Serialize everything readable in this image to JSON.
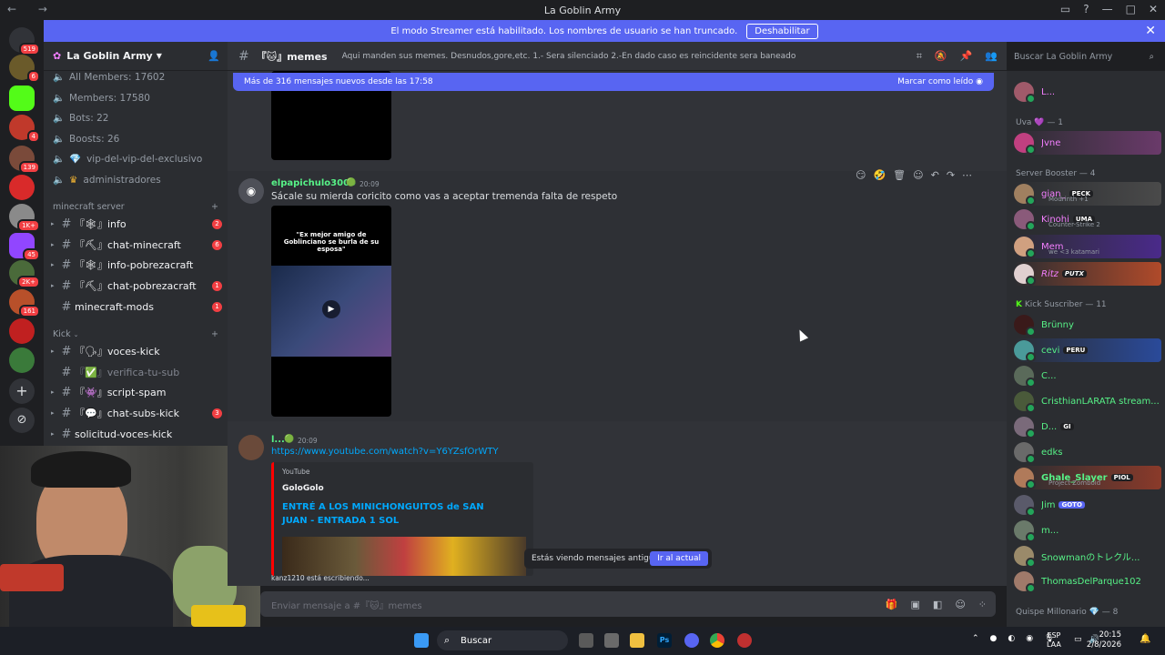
{
  "window": {
    "title": "La Goblin Army"
  },
  "banner": {
    "text": "El modo Streamer está habilitado. Los nombres de usuario se han truncado.",
    "button": "Deshabilitar"
  },
  "server": {
    "name": "La Goblin Army",
    "stats": [
      "All Members: 17602",
      "Members: 17580",
      "Bots: 22",
      "Boosts: 26",
      "vip-del-vip-del-exclusivo",
      "administradores"
    ],
    "categories": [
      {
        "label": "minecraft server",
        "channels": [
          {
            "name": "『🕸』info",
            "badge": "2"
          },
          {
            "name": "『⛏』chat-minecraft",
            "badge": "6"
          },
          {
            "name": "『🕸』info-pobrezacraft",
            "badge": ""
          },
          {
            "name": "『⛏』chat-pobrezacraft",
            "badge": "1"
          },
          {
            "name": "minecraft-mods",
            "badge": "1"
          }
        ]
      },
      {
        "label": "Kick",
        "channels": [
          {
            "name": "『🗣』voces-kick",
            "badge": ""
          },
          {
            "name": "『✅』verifica-tu-sub",
            "badge": ""
          },
          {
            "name": "『👾』script-spam",
            "badge": ""
          },
          {
            "name": "『💬』chat-subs-kick",
            "badge": "3"
          },
          {
            "name": "solicitud-voces-kick",
            "badge": ""
          }
        ]
      }
    ],
    "server_badges": [
      "519",
      "6",
      "",
      "4",
      "139",
      "",
      "1K+",
      "45",
      "2K+",
      "161"
    ]
  },
  "channel": {
    "name": "『🐱』memes",
    "topic": "Aqui manden sus memes. Desnudos,gore,etc. 1.- Sera silenciado 2.-En dado caso es reincidente sera baneado",
    "new_messages": "Más de 316 mensajes nuevos desde las 17:58",
    "mark_read": "Marcar como leído",
    "search_placeholder": "Buscar La Goblin Army"
  },
  "messages": [
    {
      "author": "elpapichulo3000",
      "time": "20:09",
      "text": "Sácale su mierda coricito como vas a aceptar tremenda falta de respeto",
      "video_caption": "\"Ex mejor amigo de Goblinciano se burla de su esposa\""
    },
    {
      "author": "l...",
      "time": "20:09",
      "link": "https://www.youtube.com/watch?v=Y6YZsfOrWTY",
      "embed": {
        "provider": "YouTube",
        "author": "GoloGolo",
        "title": "ENTRÉ A LOS MINICHONGUITOS de SAN JUAN - ENTRADA 1 SOL"
      }
    }
  ],
  "old_messages": {
    "text": "Estás viendo mensajes antiguos",
    "button": "Ir al actual"
  },
  "typing": "kanz1210 está escribiendo...",
  "composer": {
    "placeholder": "Enviar mensaje a #『🐱』memes"
  },
  "members": {
    "groups": [
      {
        "label": "Uva 💜 — 1",
        "members": [
          {
            "name": "Jvne",
            "color": "#f47fff",
            "tag": "",
            "sub": ""
          }
        ]
      },
      {
        "label": "Server Booster — 4",
        "members": [
          {
            "name": "gian_",
            "color": "#f47fff",
            "tag": "PECK",
            "sub": "Modrinth +1"
          },
          {
            "name": "Kinohi",
            "color": "#f47fff",
            "tag": "UMA",
            "sub": "Counter-Strike 2"
          },
          {
            "name": "Mem",
            "color": "#f47fff",
            "tag": "",
            "sub": "we <3 katamari"
          },
          {
            "name": "Ritz",
            "color": "#f47fff",
            "tag": "PUTX",
            "sub": ""
          }
        ]
      },
      {
        "label": "Kick Suscriber — 11",
        "members": [
          {
            "name": "Brünny",
            "color": "#57f287",
            "tag": "",
            "sub": ""
          },
          {
            "name": "cevi",
            "color": "#57f287",
            "tag": "PERU",
            "sub": ""
          },
          {
            "name": "C...",
            "color": "#57f287",
            "tag": "",
            "sub": ""
          },
          {
            "name": "CristhianLARATA stream...",
            "color": "#57f287",
            "tag": "",
            "sub": ""
          },
          {
            "name": "D...",
            "color": "#57f287",
            "tag": "GI",
            "sub": ""
          },
          {
            "name": "edks",
            "color": "#57f287",
            "tag": "",
            "sub": ""
          },
          {
            "name": "Ghale_Slayer",
            "color": "#57f287",
            "tag": "PIOL",
            "sub": "Project Zomboid"
          },
          {
            "name": "Jim",
            "color": "#57f287",
            "tag": "GOTO",
            "sub": ""
          },
          {
            "name": "m...",
            "color": "#57f287",
            "tag": "",
            "sub": ""
          },
          {
            "name": "Snowmanのトレクル...",
            "color": "#57f287",
            "tag": "",
            "sub": ""
          },
          {
            "name": "ThomasDelParque102",
            "color": "#57f287",
            "tag": "",
            "sub": ""
          }
        ]
      },
      {
        "label": "Quispe Millonario 💎 — 8",
        "members": []
      }
    ],
    "top_partial": "L..."
  },
  "taskbar": {
    "search": "Buscar",
    "lang": "ESP",
    "lang2": "LAA",
    "time": "20:15",
    "date": "2/8/2026"
  }
}
